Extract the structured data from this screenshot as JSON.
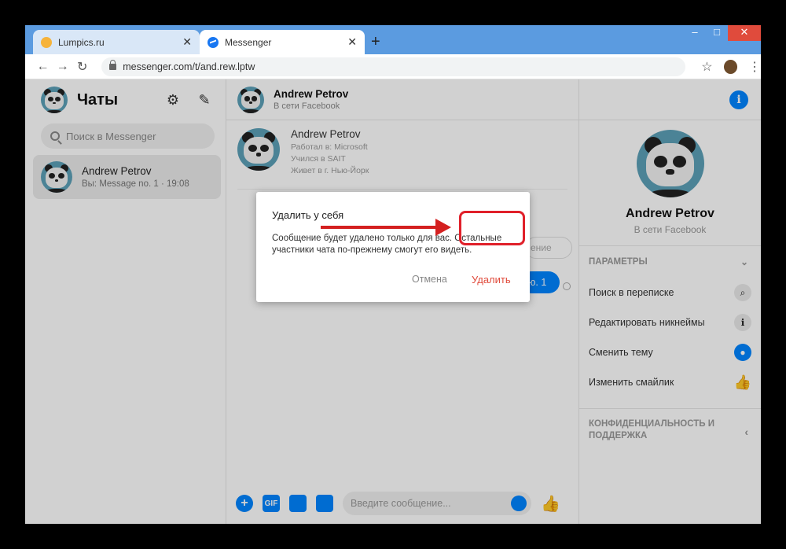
{
  "browser": {
    "tabs": [
      {
        "title": "Lumpics.ru",
        "close": "✕"
      },
      {
        "title": "Messenger",
        "close": "✕"
      }
    ],
    "new_tab": "+",
    "window_controls": {
      "minimize": "–",
      "maximize": "□",
      "close": "✕"
    },
    "nav": {
      "back": "←",
      "forward": "→",
      "reload": "↻"
    },
    "url": "messenger.com/t/and.rew.lptw",
    "star": "☆",
    "menu": "⋮"
  },
  "sidebar": {
    "title": "Чаты",
    "settings_icon": "⚙",
    "compose_icon": "✎",
    "search_placeholder": "Поиск в Messenger",
    "conversations": [
      {
        "name": "Andrew Petrov",
        "last": "Вы: Message no. 1 · 19:08"
      }
    ]
  },
  "chat": {
    "header_name": "Andrew Petrov",
    "header_status": "В сети Facebook",
    "profile": {
      "name": "Andrew Petrov",
      "lines": [
        "Работал в: Microsoft",
        "Учился в SAIT",
        "Живет в г. Нью-Йорк"
      ]
    },
    "bubble_gray": "ение",
    "bubble_blue": "ю. 1",
    "composer": {
      "gif": "GIF",
      "plus": "+",
      "placeholder": "Введите сообщение...",
      "like": "👍"
    }
  },
  "details": {
    "info": "i",
    "name": "Andrew Petrov",
    "status": "В сети Facebook",
    "params_label": "ПАРАМЕТРЫ",
    "chevron_down": "⌄",
    "options": [
      {
        "label": "Поиск в переписке",
        "icon": "⌕"
      },
      {
        "label": "Редактировать никнеймы",
        "icon": "ℹ"
      },
      {
        "label": "Сменить тему",
        "icon": "●"
      },
      {
        "label": "Изменить смайлик",
        "icon": "👍"
      }
    ],
    "privacy_label": "КОНФИДЕНЦИАЛЬНОСТЬ И ПОДДЕРЖКА",
    "chevron_left": "‹"
  },
  "dialog": {
    "title": "Удалить у себя",
    "body": "Сообщение будет удалено только для вас. Остальные участники чата по-прежнему смогут его видеть.",
    "cancel": "Отмена",
    "delete": "Удалить"
  },
  "colors": {
    "accent": "#0084ff",
    "danger": "#e04b3c",
    "annotation": "#d42020"
  }
}
